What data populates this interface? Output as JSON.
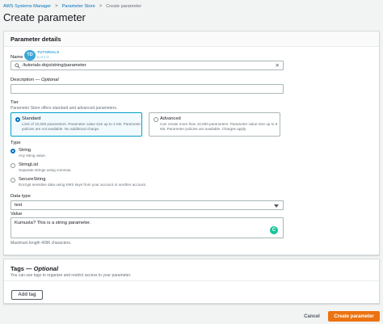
{
  "breadcrumb": {
    "items": [
      "AWS Systems Manager",
      "Parameter Store",
      "Create parameter"
    ],
    "separator": ">"
  },
  "page_title": "Create parameter",
  "details": {
    "panel_title": "Parameter details",
    "name_label": "Name",
    "name_value": "/tutorials-dojo/string/parameter",
    "clear_glyph": "✕",
    "watermark_badge": "TD",
    "watermark_text": "TUTORIALS",
    "watermark_sub": "D O J O",
    "description_label": "Description",
    "description_optional": "— Optional",
    "description_value": "",
    "tier_label": "Tier",
    "tier_desc": "Parameter Store offers standard and advanced parameters.",
    "tiers": [
      {
        "title": "Standard",
        "desc": "Limit of 10,000 parameters. Parameter value size up to 4 KB. Parameter policies are not available. No additional charge.",
        "selected": true
      },
      {
        "title": "Advanced",
        "desc": "Can create more than 10,000 parameters. Parameter value size up to 8 KB. Parameter policies are available. Charges apply.",
        "selected": false
      }
    ],
    "type_label": "Type",
    "types": [
      {
        "title": "String",
        "desc": "Any string value.",
        "selected": true
      },
      {
        "title": "StringList",
        "desc": "Separate strings using commas.",
        "selected": false
      },
      {
        "title": "SecureString",
        "desc": "Encrypt sensitive data using KMS keys from your account or another account.",
        "selected": false
      }
    ],
    "data_type_label": "Data type",
    "data_type_value": "text",
    "value_label": "Value",
    "value_text": "Kumusta? This is a string parameter.",
    "value_hint": "Maximum length 4096 characters.",
    "grammar_badge": "C"
  },
  "tags": {
    "title": "Tags",
    "optional": "— Optional",
    "desc": "You can use tags to organize and restrict access to your parameter.",
    "add_tag_label": "Add tag"
  },
  "footer": {
    "cancel_label": "Cancel",
    "create_label": "Create parameter"
  },
  "colors": {
    "primary": "#ec7211",
    "link": "#0073bb",
    "selected_border": "#00a1c9",
    "grammar_green": "#15c39a"
  },
  "icons": {
    "select_caret": "caret-down-icon",
    "clear": "close-icon",
    "grammar": "grammarly-icon"
  }
}
